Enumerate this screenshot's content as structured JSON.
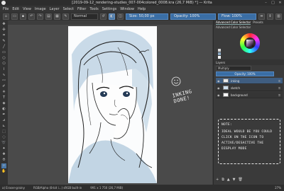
{
  "window": {
    "title": "[2019-09-12_rendering-studies_007-004colored_0008.kra (26,7 MiB) *] — Krita"
  },
  "menu": [
    "File",
    "Edit",
    "View",
    "Image",
    "Layer",
    "Select",
    "Filter",
    "Tools",
    "Settings",
    "Window",
    "Help"
  ],
  "toolbar": {
    "blend_mode": "Normal",
    "size_label": "Size: 50,00 px",
    "opacity_label": "Opacity: 100%",
    "flow_label": "Flow: 100%"
  },
  "dock": {
    "tabs": [
      "Advanced Color Selector",
      "Presets"
    ],
    "subtitle": "Advanced Color Selector",
    "layers_tabs": [
      "Layers"
    ],
    "blend_mode": "Multiply",
    "opacity_label": "Opacity: 100%",
    "layers": [
      {
        "name": "inking",
        "selected": true
      },
      {
        "name": "sketch",
        "selected": false
      },
      {
        "name": "background",
        "selected": false
      }
    ]
  },
  "canvas": {
    "annotation": "INKING DONE!"
  },
  "note": {
    "title": "NOTE:",
    "text": "IDEAL WOULD BE YOU COULD CLICK ON THE ICON TO ACTIVE/DESACTIVE THE DISPLAY MODE"
  },
  "status": {
    "brush": "a) Eraser-grainy",
    "color_space": "RGB/Alpha (8-bit i...)  sRGB built-in",
    "doc_info": "991 x 1 750 (26,7 MiB)",
    "zoom": "27%"
  },
  "colors": {
    "accent": "#4c79a8",
    "panel": "#3a3a3a",
    "canvas_bg": "#4a4a4a",
    "sketch_blue": "#a9c4d9"
  }
}
